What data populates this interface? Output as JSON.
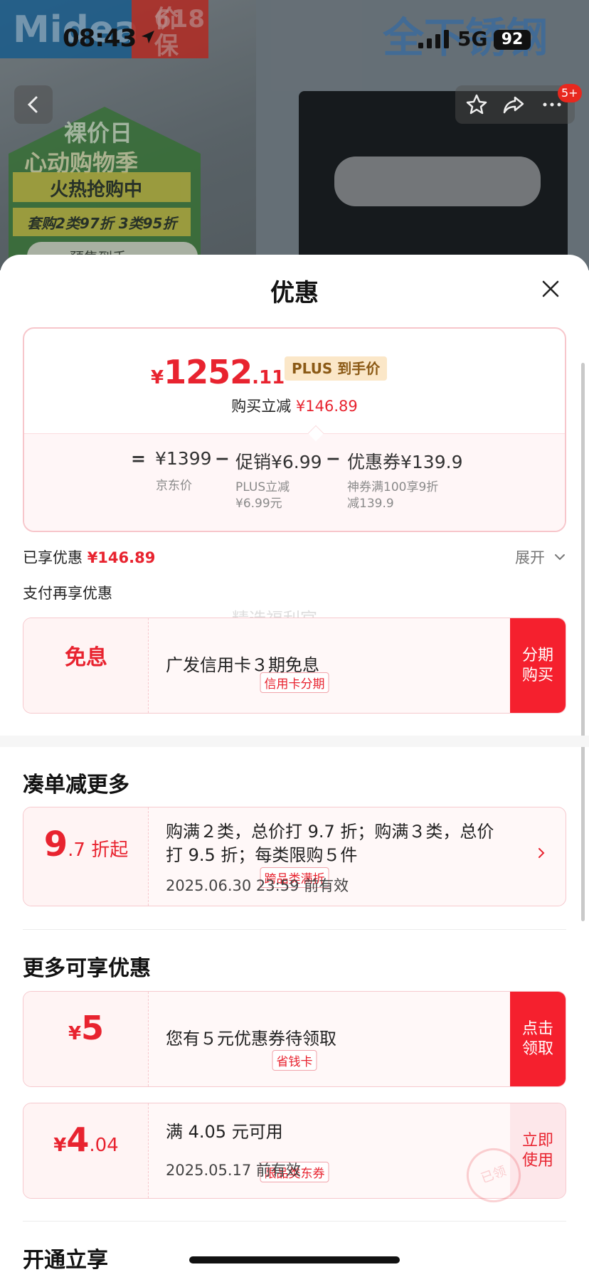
{
  "status": {
    "time": "08:43",
    "network": "5G",
    "battery": "92"
  },
  "background": {
    "brand": "Midea",
    "price_badge_line1": "价保",
    "price_badge_line2": "618",
    "house_line1": "裸价日",
    "house_line2": "心动购物季",
    "banner1": "火热抢购中",
    "banner2": "套购2类97折 3类95折",
    "pill": "预售到手",
    "headline": "全下锈钢",
    "cart_badge": "5+"
  },
  "sheet": {
    "title": "优惠"
  },
  "price": {
    "currency": "¥",
    "integer": "1252",
    "decimal": ".11",
    "plus_tag": "PLUS 到手价",
    "instant_label": "购买立减",
    "instant_value": "¥146.89"
  },
  "calc": {
    "equals": "=",
    "jd_price": "¥1399",
    "minus1": "−",
    "promo": "促销¥6.99",
    "minus2": "−",
    "coupon": "优惠券¥139.9",
    "jd_price_sub": "京东价",
    "promo_sub_1": "PLUS立减",
    "promo_sub_2": "¥6.99元",
    "coupon_sub_1": "神券满100享9折",
    "coupon_sub_2": "减139.9"
  },
  "enjoyed": {
    "label": "已享优惠",
    "value": "¥146.89",
    "expand": "展开"
  },
  "pay": {
    "title": "支付再享优惠",
    "watermark": "精选福利官",
    "card": {
      "big": "免息",
      "tag": "信用卡分期",
      "desc": "广发信用卡３期免息",
      "action": "分期购买"
    }
  },
  "bundle": {
    "title": "凑单减更多",
    "card": {
      "big_int": "9",
      "big_rest": ".7 折起",
      "tag": "跨品类满折",
      "desc_line1": "购满２类，总价打 9.7 折；购满３类，总价",
      "desc_line2": "打 9.5 折；每类限购５件",
      "date": "2025.06.30 23:59 前有效"
    }
  },
  "more": {
    "title": "更多可享优惠",
    "card1": {
      "currency": "¥",
      "amount": "5",
      "tag": "省钱卡",
      "desc": "您有５元优惠券待领取",
      "action": "点击领取"
    },
    "card2": {
      "currency": "¥",
      "amount": "4",
      "decimal": ".04",
      "tag": "限品类东券",
      "desc": "满 4.05 元可用",
      "date": "2025.05.17 前有效",
      "action": "立即使用",
      "stamp": "已领"
    }
  },
  "open": {
    "title": "开通立享"
  },
  "colors": {
    "accent_red": "#e8232f",
    "action_red": "#f5202e",
    "plus_gold": "#8b5a16"
  }
}
